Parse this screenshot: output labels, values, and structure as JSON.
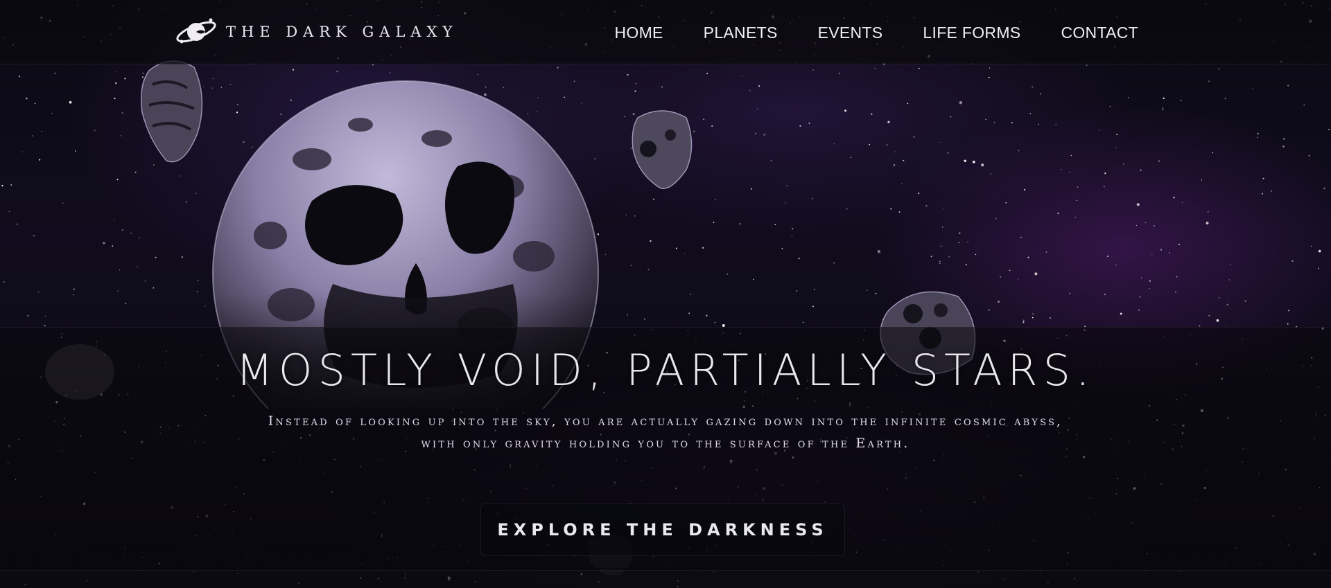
{
  "site": {
    "brand_name": "THE DARK GALAXY",
    "logo_icon": "planet-with-ring-icon"
  },
  "nav": {
    "items": [
      {
        "label": "HOME"
      },
      {
        "label": "PLANETS"
      },
      {
        "label": "EVENTS"
      },
      {
        "label": "LIFE FORMS"
      },
      {
        "label": "CONTACT"
      }
    ]
  },
  "hero": {
    "title": "MOSTLY VOID, PARTIALLY STARS.",
    "subtitle": "Instead of looking up into the sky, you are actually gazing down into the infinite cosmic abyss, with only gravity holding you to the surface of the Earth.",
    "cta_label": "EXPLORE THE DARKNESS"
  },
  "colors": {
    "background": "#0a0910",
    "text": "#ece8f2",
    "nebula": "#5c1e78",
    "moon_light": "#aea6c8",
    "moon_dark": "#2a2636"
  }
}
